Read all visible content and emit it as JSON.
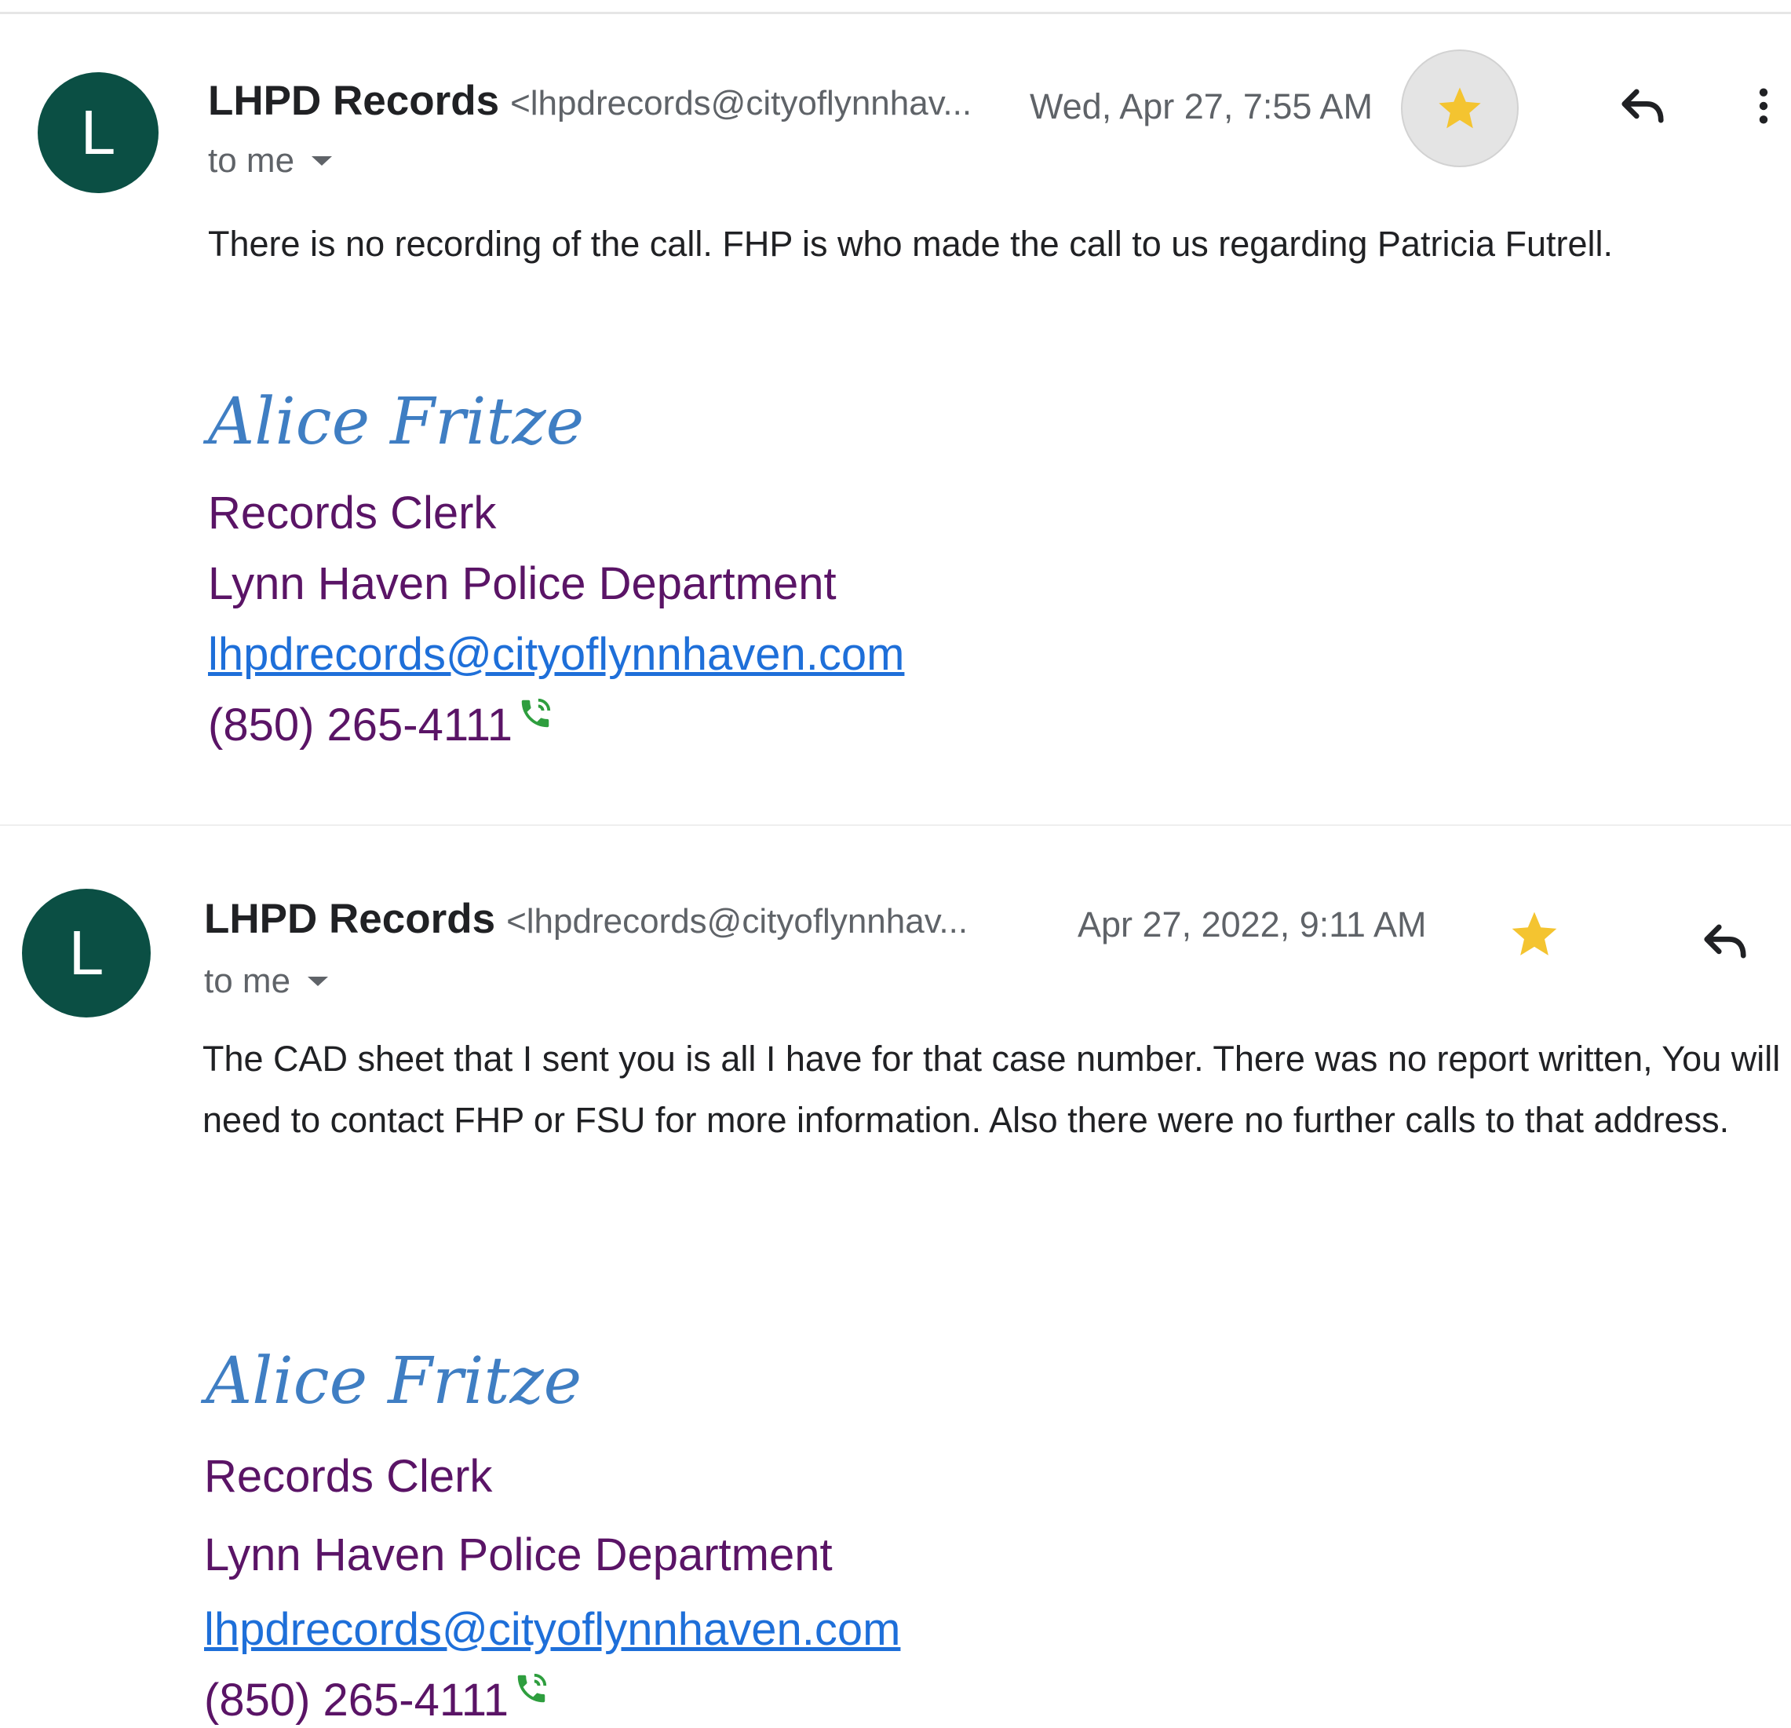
{
  "messages": [
    {
      "avatar_letter": "L",
      "sender_name": "LHPD Records",
      "sender_email": "<lhpdrecords@cityoflynnhav...",
      "date": "Wed, Apr 27, 7:55 AM",
      "recipient": "to me",
      "starred": true,
      "body": "There is no recording of the call.  FHP is who made the call to us regarding Patricia Futrell.",
      "signature": {
        "name": "Alice Fritze",
        "title": "Records Clerk",
        "department": "Lynn Haven Police Department",
        "email": "lhpdrecords@cityoflynnhaven.com",
        "phone": "(850) 265-4111"
      }
    },
    {
      "avatar_letter": "L",
      "sender_name": "LHPD Records",
      "sender_email": "<lhpdrecords@cityoflynnhav...",
      "date": "Apr 27, 2022, 9:11 AM",
      "recipient": "to me",
      "starred": true,
      "body": "The CAD sheet that I sent you is all I have for that case number.  There was no report written,  You will need to contact FHP or FSU for more information.  Also there were no further calls to that address.",
      "signature": {
        "name": "Alice Fritze",
        "title": "Records Clerk",
        "department": "Lynn Haven Police Department",
        "email": "lhpdrecords@cityoflynnhaven.com",
        "phone": "(850) 265-4111"
      }
    }
  ],
  "colors": {
    "avatar": "#0b4f44",
    "star": "#f4c430",
    "signature_name": "#3f7ec3",
    "signature_text": "#5a1466",
    "link": "#1e6fd9",
    "phone_icon": "#2e9e3e"
  },
  "icons": [
    "star-icon",
    "reply-icon",
    "more-vert-icon",
    "dropdown-arrow-icon",
    "phone-icon"
  ]
}
